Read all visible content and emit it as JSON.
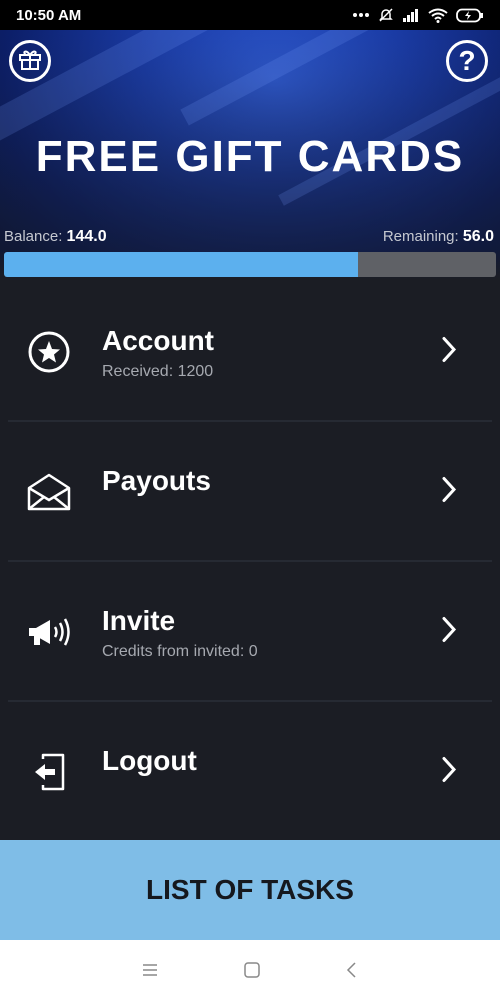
{
  "status_bar": {
    "time": "10:50 AM",
    "icons": [
      "more-dots-icon",
      "bell-off-icon",
      "signal-icon",
      "wifi-icon",
      "battery-charging-icon"
    ]
  },
  "header": {
    "title": "FREE GIFT CARDS",
    "gift_icon": "gift-icon",
    "help_icon": "help-icon",
    "help_glyph": "?",
    "balance_label": "Balance: ",
    "balance_value": "144.0",
    "remaining_label": "Remaining: ",
    "remaining_value": "56.0",
    "progress_percent": 72
  },
  "menu": {
    "items": [
      {
        "label": "Account",
        "sub": "Received: 1200",
        "icon": "star-circle-icon"
      },
      {
        "label": "Payouts",
        "sub": "",
        "icon": "envelope-icon"
      },
      {
        "label": "Invite",
        "sub": "Credits from invited: 0",
        "icon": "megaphone-icon"
      },
      {
        "label": "Logout",
        "sub": "",
        "icon": "logout-icon"
      }
    ]
  },
  "footer": {
    "tasks_label": "LIST OF TASKS"
  },
  "nav": {
    "icons": [
      "menu-icon",
      "home-square-icon",
      "back-icon"
    ]
  },
  "colors": {
    "accent": "#5cb0ee",
    "button_bg": "#7fbde7",
    "background": "#1b1d24",
    "progress_track": "#5f6166"
  }
}
